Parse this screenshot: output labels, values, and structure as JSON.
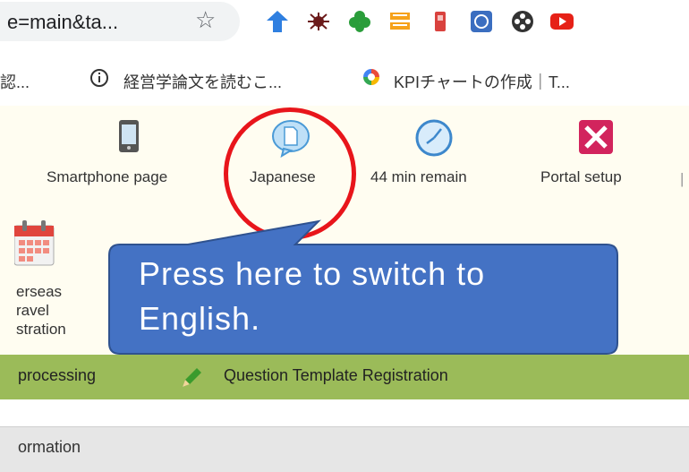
{
  "browser": {
    "url_fragment": "e=main&ta...",
    "bookmarks": [
      {
        "label": "認..."
      },
      {
        "label": "経営学論文を読むこ..."
      },
      {
        "label": "KPIチャートの作成｜T..."
      }
    ]
  },
  "toolbar": {
    "items": [
      {
        "label": "Smartphone page",
        "icon": "smartphone-icon"
      },
      {
        "label": "Japanese",
        "icon": "language-bubble-icon"
      },
      {
        "label": "44 min remain",
        "icon": "clock-icon"
      },
      {
        "label": "Portal setup",
        "icon": "tools-icon"
      }
    ]
  },
  "travel_tile": {
    "line1": "erseas",
    "line2": "ravel",
    "line3": "stration",
    "icon": "calendar-icon"
  },
  "menu": {
    "items": [
      {
        "label": "processing"
      },
      {
        "label": "Question Template Registration",
        "icon": "pencil-icon"
      }
    ]
  },
  "info_header": "ormation",
  "callout": {
    "line1": "Press here to switch to",
    "line2": "English.",
    "color": "#4472c4",
    "ring_color": "#e8151b"
  }
}
